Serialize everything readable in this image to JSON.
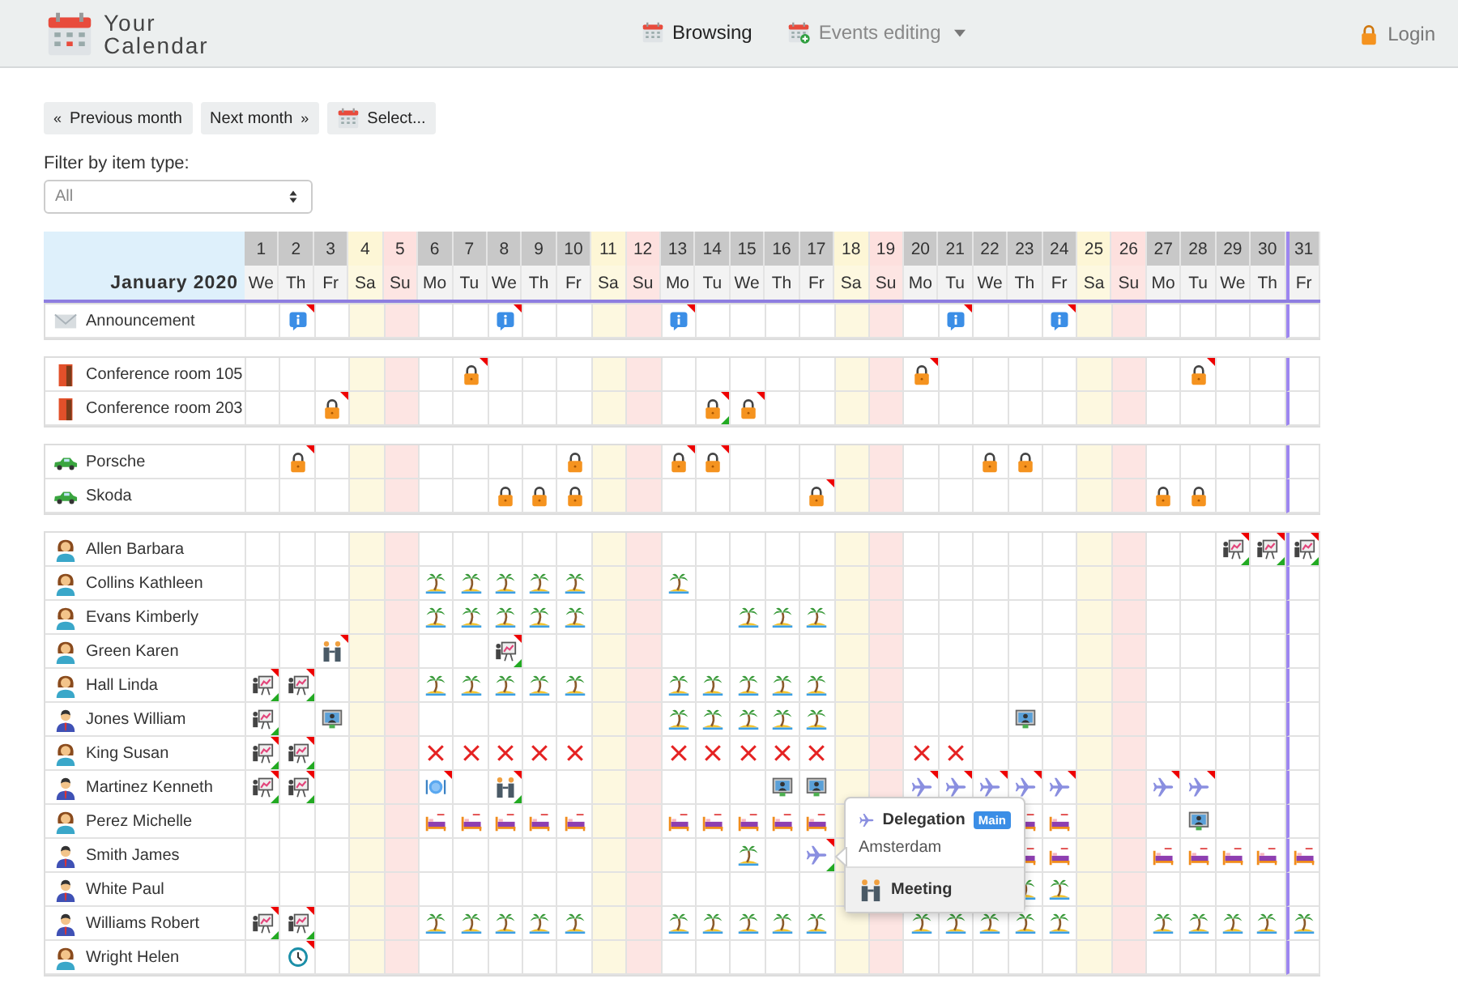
{
  "navbar": {
    "logo": {
      "line1": "Your",
      "line2": "Calendar"
    },
    "links": [
      {
        "label": "Browsing",
        "kind": "calendar",
        "selected": true,
        "dropdown": false
      },
      {
        "label": "Events editing",
        "kind": "calendar-add",
        "selected": false,
        "dropdown": true
      }
    ],
    "login": "Login"
  },
  "toolbar": {
    "buttons": [
      {
        "kind": "prev",
        "arrow": "«",
        "label": "Previous month"
      },
      {
        "kind": "next",
        "arrow": "»",
        "label": "Next month"
      },
      {
        "kind": "select",
        "label": "Select..."
      }
    ]
  },
  "filter": {
    "label": "Filter by item type:",
    "value": "All"
  },
  "calendar": {
    "title": "January 2020",
    "days": [
      {
        "number": "1",
        "weekday": "We",
        "kind": "weekday",
        "today": false
      },
      {
        "number": "2",
        "weekday": "Th",
        "kind": "weekday",
        "today": false
      },
      {
        "number": "3",
        "weekday": "Fr",
        "kind": "weekday",
        "today": false
      },
      {
        "number": "4",
        "weekday": "Sa",
        "kind": "saturday",
        "today": false
      },
      {
        "number": "5",
        "weekday": "Su",
        "kind": "sunday",
        "today": false
      },
      {
        "number": "6",
        "weekday": "Mo",
        "kind": "weekday",
        "today": false
      },
      {
        "number": "7",
        "weekday": "Tu",
        "kind": "weekday",
        "today": false
      },
      {
        "number": "8",
        "weekday": "We",
        "kind": "weekday",
        "today": false
      },
      {
        "number": "9",
        "weekday": "Th",
        "kind": "weekday",
        "today": false
      },
      {
        "number": "10",
        "weekday": "Fr",
        "kind": "weekday",
        "today": false
      },
      {
        "number": "11",
        "weekday": "Sa",
        "kind": "saturday",
        "today": false
      },
      {
        "number": "12",
        "weekday": "Su",
        "kind": "sunday",
        "today": false
      },
      {
        "number": "13",
        "weekday": "Mo",
        "kind": "weekday",
        "today": false
      },
      {
        "number": "14",
        "weekday": "Tu",
        "kind": "weekday",
        "today": false
      },
      {
        "number": "15",
        "weekday": "We",
        "kind": "weekday",
        "today": false
      },
      {
        "number": "16",
        "weekday": "Th",
        "kind": "weekday",
        "today": false
      },
      {
        "number": "17",
        "weekday": "Fr",
        "kind": "weekday",
        "today": false
      },
      {
        "number": "18",
        "weekday": "Sa",
        "kind": "saturday",
        "today": false
      },
      {
        "number": "19",
        "weekday": "Su",
        "kind": "sunday",
        "today": false
      },
      {
        "number": "20",
        "weekday": "Mo",
        "kind": "weekday",
        "today": false
      },
      {
        "number": "21",
        "weekday": "Tu",
        "kind": "weekday",
        "today": false
      },
      {
        "number": "22",
        "weekday": "We",
        "kind": "weekday",
        "today": false
      },
      {
        "number": "23",
        "weekday": "Th",
        "kind": "weekday",
        "today": false
      },
      {
        "number": "24",
        "weekday": "Fr",
        "kind": "weekday",
        "today": false
      },
      {
        "number": "25",
        "weekday": "Sa",
        "kind": "saturday",
        "today": false
      },
      {
        "number": "26",
        "weekday": "Su",
        "kind": "sunday",
        "today": false
      },
      {
        "number": "27",
        "weekday": "Mo",
        "kind": "weekday",
        "today": false
      },
      {
        "number": "28",
        "weekday": "Tu",
        "kind": "weekday",
        "today": false
      },
      {
        "number": "29",
        "weekday": "We",
        "kind": "weekday",
        "today": false
      },
      {
        "number": "30",
        "weekday": "Th",
        "kind": "weekday",
        "today": false
      },
      {
        "number": "31",
        "weekday": "Fr",
        "kind": "weekday",
        "today": true
      }
    ],
    "groups": [
      {
        "rows": [
          {
            "name": "Announcement",
            "kind": "envelope",
            "cells": [
              null,
              {
                "kind": "info",
                "flagged": true,
                "approved": false
              },
              null,
              null,
              null,
              null,
              null,
              {
                "kind": "info",
                "flagged": true,
                "approved": false
              },
              null,
              null,
              null,
              null,
              {
                "kind": "info",
                "flagged": true,
                "approved": false
              },
              null,
              null,
              null,
              null,
              null,
              null,
              null,
              {
                "kind": "info",
                "flagged": true,
                "approved": false
              },
              null,
              null,
              {
                "kind": "info",
                "flagged": true,
                "approved": false
              },
              null,
              null,
              null,
              null,
              null,
              null,
              null
            ]
          }
        ]
      },
      {
        "rows": [
          {
            "name": "Conference room 105",
            "kind": "door",
            "cells": [
              null,
              null,
              null,
              null,
              null,
              null,
              {
                "kind": "lock",
                "flagged": true,
                "approved": false
              },
              null,
              null,
              null,
              null,
              null,
              null,
              null,
              null,
              null,
              null,
              null,
              null,
              {
                "kind": "lock",
                "flagged": true,
                "approved": false
              },
              null,
              null,
              null,
              null,
              null,
              null,
              null,
              {
                "kind": "lock",
                "flagged": true,
                "approved": false
              },
              null,
              null,
              null
            ]
          },
          {
            "name": "Conference room 203",
            "kind": "door",
            "cells": [
              null,
              null,
              {
                "kind": "lock",
                "flagged": true,
                "approved": false
              },
              null,
              null,
              null,
              null,
              null,
              null,
              null,
              null,
              null,
              null,
              {
                "kind": "lock",
                "flagged": true,
                "approved": true
              },
              {
                "kind": "lock",
                "flagged": true,
                "approved": false
              },
              null,
              null,
              null,
              null,
              null,
              null,
              null,
              null,
              null,
              null,
              null,
              null,
              null,
              null,
              null,
              null
            ]
          }
        ]
      },
      {
        "rows": [
          {
            "name": "Porsche",
            "kind": "car",
            "cells": [
              null,
              {
                "kind": "lock",
                "flagged": true,
                "approved": false
              },
              null,
              null,
              null,
              null,
              null,
              null,
              null,
              {
                "kind": "lock",
                "flagged": false,
                "approved": false
              },
              null,
              null,
              {
                "kind": "lock",
                "flagged": true,
                "approved": false
              },
              {
                "kind": "lock",
                "flagged": true,
                "approved": false
              },
              null,
              null,
              null,
              null,
              null,
              null,
              null,
              {
                "kind": "lock",
                "flagged": false,
                "approved": false
              },
              {
                "kind": "lock",
                "flagged": false,
                "approved": false
              },
              null,
              null,
              null,
              null,
              null,
              null,
              null,
              null
            ]
          },
          {
            "name": "Skoda",
            "kind": "car",
            "cells": [
              null,
              null,
              null,
              null,
              null,
              null,
              null,
              {
                "kind": "lock",
                "flagged": false,
                "approved": false
              },
              {
                "kind": "lock",
                "flagged": false,
                "approved": false
              },
              {
                "kind": "lock",
                "flagged": false,
                "approved": false
              },
              null,
              null,
              null,
              null,
              null,
              null,
              {
                "kind": "lock",
                "flagged": true,
                "approved": false
              },
              null,
              null,
              null,
              null,
              null,
              null,
              null,
              null,
              null,
              {
                "kind": "lock",
                "flagged": false,
                "approved": false
              },
              {
                "kind": "lock",
                "flagged": false,
                "approved": false
              },
              null,
              null,
              null
            ]
          }
        ]
      },
      {
        "rows": [
          {
            "name": "Allen Barbara",
            "kind": "woman",
            "cells": [
              null,
              null,
              null,
              null,
              null,
              null,
              null,
              null,
              null,
              null,
              null,
              null,
              null,
              null,
              null,
              null,
              null,
              null,
              null,
              null,
              null,
              null,
              null,
              null,
              null,
              null,
              null,
              null,
              {
                "kind": "presentation",
                "flagged": true,
                "approved": true
              },
              {
                "kind": "presentation",
                "flagged": true,
                "approved": true
              },
              {
                "kind": "presentation",
                "flagged": true,
                "approved": true
              }
            ]
          },
          {
            "name": "Collins Kathleen",
            "kind": "woman",
            "cells": [
              null,
              null,
              null,
              null,
              null,
              {
                "kind": "palm",
                "flagged": false,
                "approved": false
              },
              {
                "kind": "palm",
                "flagged": false,
                "approved": false
              },
              {
                "kind": "palm",
                "flagged": false,
                "approved": false
              },
              {
                "kind": "palm",
                "flagged": false,
                "approved": false
              },
              {
                "kind": "palm",
                "flagged": false,
                "approved": false
              },
              null,
              null,
              {
                "kind": "palm",
                "flagged": false,
                "approved": false
              },
              null,
              null,
              null,
              null,
              null,
              null,
              null,
              null,
              null,
              null,
              null,
              null,
              null,
              null,
              null,
              null,
              null,
              null
            ]
          },
          {
            "name": "Evans Kimberly",
            "kind": "woman",
            "cells": [
              null,
              null,
              null,
              null,
              null,
              {
                "kind": "palm",
                "flagged": false,
                "approved": false
              },
              {
                "kind": "palm",
                "flagged": false,
                "approved": false
              },
              {
                "kind": "palm",
                "flagged": false,
                "approved": false
              },
              {
                "kind": "palm",
                "flagged": false,
                "approved": false
              },
              {
                "kind": "palm",
                "flagged": false,
                "approved": false
              },
              null,
              null,
              null,
              null,
              {
                "kind": "palm",
                "flagged": false,
                "approved": false
              },
              {
                "kind": "palm",
                "flagged": false,
                "approved": false
              },
              {
                "kind": "palm",
                "flagged": false,
                "approved": false
              },
              null,
              null,
              null,
              null,
              null,
              null,
              null,
              null,
              null,
              null,
              null,
              null,
              null,
              null
            ]
          },
          {
            "name": "Green Karen",
            "kind": "woman",
            "cells": [
              null,
              null,
              {
                "kind": "meeting",
                "flagged": true,
                "approved": false
              },
              null,
              null,
              null,
              null,
              {
                "kind": "presentation",
                "flagged": true,
                "approved": true
              },
              null,
              null,
              null,
              null,
              null,
              null,
              null,
              null,
              null,
              null,
              null,
              null,
              null,
              null,
              null,
              null,
              null,
              null,
              null,
              null,
              null,
              null,
              null
            ]
          },
          {
            "name": "Hall Linda",
            "kind": "woman",
            "cells": [
              {
                "kind": "presentation",
                "flagged": true,
                "approved": true
              },
              {
                "kind": "presentation",
                "flagged": true,
                "approved": true
              },
              null,
              null,
              null,
              {
                "kind": "palm",
                "flagged": false,
                "approved": false
              },
              {
                "kind": "palm",
                "flagged": false,
                "approved": false
              },
              {
                "kind": "palm",
                "flagged": false,
                "approved": false
              },
              {
                "kind": "palm",
                "flagged": false,
                "approved": false
              },
              {
                "kind": "palm",
                "flagged": false,
                "approved": false
              },
              null,
              null,
              {
                "kind": "palm",
                "flagged": false,
                "approved": false
              },
              {
                "kind": "palm",
                "flagged": false,
                "approved": false
              },
              {
                "kind": "palm",
                "flagged": false,
                "approved": false
              },
              {
                "kind": "palm",
                "flagged": false,
                "approved": false
              },
              {
                "kind": "palm",
                "flagged": false,
                "approved": false
              },
              null,
              null,
              null,
              null,
              null,
              null,
              null,
              null,
              null,
              null,
              null,
              null,
              null,
              null
            ]
          },
          {
            "name": "Jones William",
            "kind": "man",
            "cells": [
              {
                "kind": "presentation",
                "flagged": false,
                "approved": true
              },
              null,
              {
                "kind": "monitor",
                "flagged": false,
                "approved": false
              },
              null,
              null,
              null,
              null,
              null,
              null,
              null,
              null,
              null,
              {
                "kind": "palm",
                "flagged": false,
                "approved": false
              },
              {
                "kind": "palm",
                "flagged": false,
                "approved": false
              },
              {
                "kind": "palm",
                "flagged": false,
                "approved": false
              },
              {
                "kind": "palm",
                "flagged": false,
                "approved": false
              },
              {
                "kind": "palm",
                "flagged": false,
                "approved": false
              },
              null,
              null,
              null,
              null,
              null,
              {
                "kind": "monitor",
                "flagged": false,
                "approved": false
              },
              null,
              null,
              null,
              null,
              null,
              null,
              null,
              null
            ]
          },
          {
            "name": "King Susan",
            "kind": "woman",
            "cells": [
              {
                "kind": "presentation",
                "flagged": true,
                "approved": true
              },
              {
                "kind": "presentation",
                "flagged": true,
                "approved": true
              },
              null,
              null,
              null,
              {
                "kind": "cross",
                "flagged": false,
                "approved": false
              },
              {
                "kind": "cross",
                "flagged": false,
                "approved": false
              },
              {
                "kind": "cross",
                "flagged": false,
                "approved": false
              },
              {
                "kind": "cross",
                "flagged": false,
                "approved": false
              },
              {
                "kind": "cross",
                "flagged": false,
                "approved": false
              },
              null,
              null,
              {
                "kind": "cross",
                "flagged": false,
                "approved": false
              },
              {
                "kind": "cross",
                "flagged": false,
                "approved": false
              },
              {
                "kind": "cross",
                "flagged": false,
                "approved": false
              },
              {
                "kind": "cross",
                "flagged": false,
                "approved": false
              },
              {
                "kind": "cross",
                "flagged": false,
                "approved": false
              },
              null,
              null,
              {
                "kind": "cross",
                "flagged": false,
                "approved": false
              },
              {
                "kind": "cross",
                "flagged": false,
                "approved": false
              },
              null,
              null,
              null,
              null,
              null,
              null,
              null,
              null,
              null,
              null
            ]
          },
          {
            "name": "Martinez Kenneth",
            "kind": "man",
            "cells": [
              {
                "kind": "presentation",
                "flagged": true,
                "approved": true
              },
              {
                "kind": "presentation",
                "flagged": true,
                "approved": true
              },
              null,
              null,
              null,
              {
                "kind": "dinner",
                "flagged": true,
                "approved": false
              },
              null,
              {
                "kind": "meeting",
                "flagged": true,
                "approved": true
              },
              null,
              null,
              null,
              null,
              null,
              null,
              null,
              {
                "kind": "monitor",
                "flagged": false,
                "approved": false
              },
              {
                "kind": "monitor",
                "flagged": false,
                "approved": false
              },
              null,
              null,
              {
                "kind": "plane",
                "flagged": true,
                "approved": false
              },
              {
                "kind": "plane",
                "flagged": true,
                "approved": false
              },
              {
                "kind": "plane",
                "flagged": true,
                "approved": false
              },
              {
                "kind": "plane",
                "flagged": true,
                "approved": false
              },
              {
                "kind": "plane",
                "flagged": true,
                "approved": false
              },
              null,
              null,
              {
                "kind": "plane",
                "flagged": true,
                "approved": false
              },
              {
                "kind": "plane",
                "flagged": true,
                "approved": false
              },
              null,
              null,
              null
            ]
          },
          {
            "name": "Perez Michelle",
            "kind": "woman",
            "cells": [
              null,
              null,
              null,
              null,
              null,
              {
                "kind": "bed",
                "flagged": false,
                "approved": false
              },
              {
                "kind": "bed",
                "flagged": false,
                "approved": false
              },
              {
                "kind": "bed",
                "flagged": false,
                "approved": false
              },
              {
                "kind": "bed",
                "flagged": false,
                "approved": false
              },
              {
                "kind": "bed",
                "flagged": false,
                "approved": false
              },
              null,
              null,
              {
                "kind": "bed",
                "flagged": false,
                "approved": false
              },
              {
                "kind": "bed",
                "flagged": false,
                "approved": false
              },
              {
                "kind": "bed",
                "flagged": false,
                "approved": false
              },
              {
                "kind": "bed",
                "flagged": false,
                "approved": false
              },
              {
                "kind": "bed",
                "flagged": false,
                "approved": false
              },
              null,
              null,
              null,
              null,
              null,
              {
                "kind": "bed",
                "flagged": false,
                "approved": false
              },
              {
                "kind": "bed",
                "flagged": false,
                "approved": false
              },
              null,
              null,
              null,
              {
                "kind": "monitor",
                "flagged": false,
                "approved": false
              },
              null,
              null,
              null
            ]
          },
          {
            "name": "Smith James",
            "kind": "man",
            "cells": [
              null,
              null,
              null,
              null,
              null,
              null,
              null,
              null,
              null,
              null,
              null,
              null,
              null,
              null,
              {
                "kind": "palm",
                "flagged": false,
                "approved": false
              },
              null,
              {
                "kind": "plane",
                "flagged": true,
                "approved": true
              },
              null,
              null,
              null,
              null,
              null,
              {
                "kind": "bed",
                "flagged": false,
                "approved": false
              },
              {
                "kind": "bed",
                "flagged": false,
                "approved": false
              },
              null,
              null,
              {
                "kind": "bed",
                "flagged": false,
                "approved": false
              },
              {
                "kind": "bed",
                "flagged": false,
                "approved": false
              },
              {
                "kind": "bed",
                "flagged": false,
                "approved": false
              },
              {
                "kind": "bed",
                "flagged": false,
                "approved": false
              },
              {
                "kind": "bed",
                "flagged": false,
                "approved": false
              }
            ]
          },
          {
            "name": "White Paul",
            "kind": "man",
            "cells": [
              null,
              null,
              null,
              null,
              null,
              null,
              null,
              null,
              null,
              null,
              null,
              null,
              null,
              null,
              null,
              null,
              null,
              null,
              null,
              null,
              null,
              null,
              {
                "kind": "palm",
                "flagged": false,
                "approved": false
              },
              {
                "kind": "palm",
                "flagged": false,
                "approved": false
              },
              null,
              null,
              null,
              null,
              null,
              null,
              null
            ]
          },
          {
            "name": "Williams Robert",
            "kind": "man",
            "cells": [
              {
                "kind": "presentation",
                "flagged": true,
                "approved": true
              },
              {
                "kind": "presentation",
                "flagged": true,
                "approved": true
              },
              null,
              null,
              null,
              {
                "kind": "palm",
                "flagged": false,
                "approved": false
              },
              {
                "kind": "palm",
                "flagged": false,
                "approved": false
              },
              {
                "kind": "palm",
                "flagged": false,
                "approved": false
              },
              {
                "kind": "palm",
                "flagged": false,
                "approved": false
              },
              {
                "kind": "palm",
                "flagged": false,
                "approved": false
              },
              null,
              null,
              {
                "kind": "palm",
                "flagged": false,
                "approved": false
              },
              {
                "kind": "palm",
                "flagged": false,
                "approved": false
              },
              {
                "kind": "palm",
                "flagged": false,
                "approved": false
              },
              {
                "kind": "palm",
                "flagged": false,
                "approved": false
              },
              {
                "kind": "palm",
                "flagged": false,
                "approved": false
              },
              null,
              null,
              {
                "kind": "palm",
                "flagged": false,
                "approved": false
              },
              {
                "kind": "palm",
                "flagged": false,
                "approved": false
              },
              {
                "kind": "palm",
                "flagged": false,
                "approved": false
              },
              {
                "kind": "palm",
                "flagged": false,
                "approved": false
              },
              {
                "kind": "palm",
                "flagged": false,
                "approved": false
              },
              null,
              null,
              {
                "kind": "palm",
                "flagged": false,
                "approved": false
              },
              {
                "kind": "palm",
                "flagged": false,
                "approved": false
              },
              {
                "kind": "palm",
                "flagged": false,
                "approved": false
              },
              {
                "kind": "palm",
                "flagged": false,
                "approved": false
              },
              {
                "kind": "palm",
                "flagged": false,
                "approved": false
              }
            ]
          },
          {
            "name": "Wright Helen",
            "kind": "woman",
            "cells": [
              null,
              {
                "kind": "clock",
                "flagged": true,
                "approved": false
              },
              null,
              null,
              null,
              null,
              null,
              null,
              null,
              null,
              null,
              null,
              null,
              null,
              null,
              null,
              null,
              null,
              null,
              null,
              null,
              null,
              null,
              null,
              null,
              null,
              null,
              null,
              null,
              null,
              null
            ]
          }
        ]
      }
    ]
  },
  "popup": {
    "items": [
      {
        "kind": "plane",
        "title": "Delegation",
        "badge": "Main",
        "subtitle": "Amsterdam",
        "highlighted": false
      },
      {
        "kind": "meeting",
        "title": "Meeting",
        "highlighted": true
      }
    ]
  }
}
